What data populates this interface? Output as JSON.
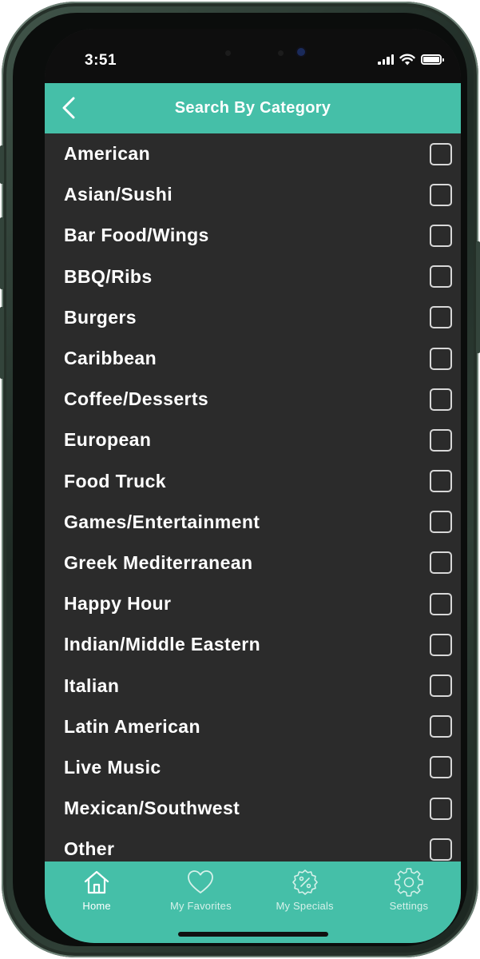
{
  "status_bar": {
    "time": "3:51",
    "icons": [
      "cellular-signal-icon",
      "wifi-icon",
      "battery-icon"
    ],
    "battery_level": 1.0
  },
  "header": {
    "title": "Search By Category",
    "back_icon": "chevron-left-icon"
  },
  "categories": [
    {
      "label": "American",
      "checked": false
    },
    {
      "label": "Asian/Sushi",
      "checked": false
    },
    {
      "label": "Bar Food/Wings",
      "checked": false
    },
    {
      "label": "BBQ/Ribs",
      "checked": false
    },
    {
      "label": "Burgers",
      "checked": false
    },
    {
      "label": "Caribbean",
      "checked": false
    },
    {
      "label": "Coffee/Desserts",
      "checked": false
    },
    {
      "label": "European",
      "checked": false
    },
    {
      "label": "Food Truck",
      "checked": false
    },
    {
      "label": "Games/Entertainment",
      "checked": false
    },
    {
      "label": "Greek Mediterranean",
      "checked": false
    },
    {
      "label": "Happy Hour",
      "checked": false
    },
    {
      "label": "Indian/Middle Eastern",
      "checked": false
    },
    {
      "label": "Italian",
      "checked": false
    },
    {
      "label": "Latin American",
      "checked": false
    },
    {
      "label": "Live Music",
      "checked": false
    },
    {
      "label": "Mexican/Southwest",
      "checked": false
    },
    {
      "label": "Other",
      "checked": false
    }
  ],
  "tabbar": {
    "tabs": [
      {
        "label": "Home",
        "icon": "home-icon",
        "active": true
      },
      {
        "label": "My Favorites",
        "icon": "heart-icon",
        "active": false
      },
      {
        "label": "My Specials",
        "icon": "percent-badge-icon",
        "active": false
      },
      {
        "label": "Settings",
        "icon": "gear-icon",
        "active": false
      }
    ]
  },
  "colors": {
    "accent": "#45bfa8",
    "background": "#2b2b2b",
    "text": "#ffffff",
    "inactive_tab": "#d6f1ea"
  }
}
